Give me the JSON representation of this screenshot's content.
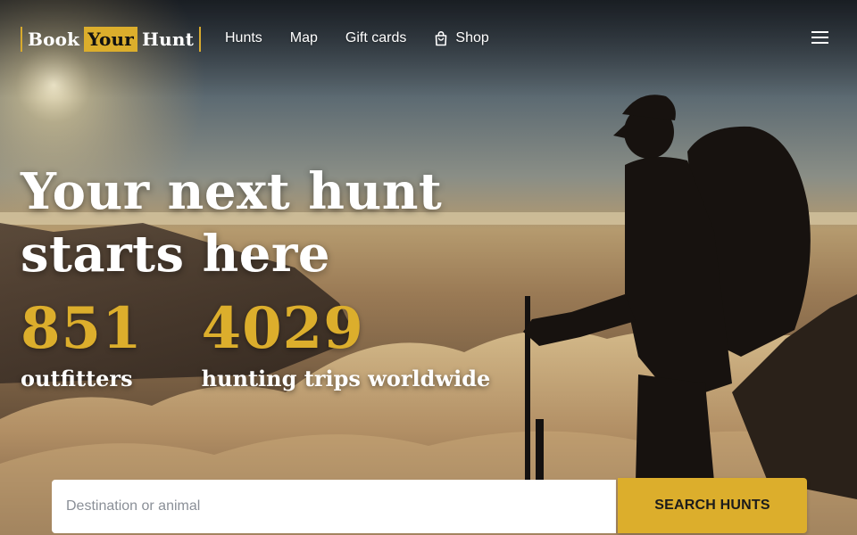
{
  "header": {
    "logo": {
      "part1": "Book",
      "part2": "Your",
      "part3": "Hunt"
    },
    "nav": [
      {
        "label": "Hunts"
      },
      {
        "label": "Map"
      },
      {
        "label": "Gift cards"
      },
      {
        "label": "Shop",
        "icon": "shopping-bag-icon"
      }
    ],
    "menu_icon": "hamburger-menu-icon"
  },
  "hero": {
    "headline_line1": "Your next hunt",
    "headline_line2": "starts here",
    "stats": [
      {
        "value": "851",
        "label": "outfitters"
      },
      {
        "value": "4029",
        "label": "hunting trips worldwide"
      }
    ]
  },
  "search": {
    "placeholder": "Destination or animal",
    "value": "",
    "button_label": "SEARCH HUNTS"
  },
  "colors": {
    "accent": "#dcae2c",
    "text_on_dark": "#ffffff"
  }
}
